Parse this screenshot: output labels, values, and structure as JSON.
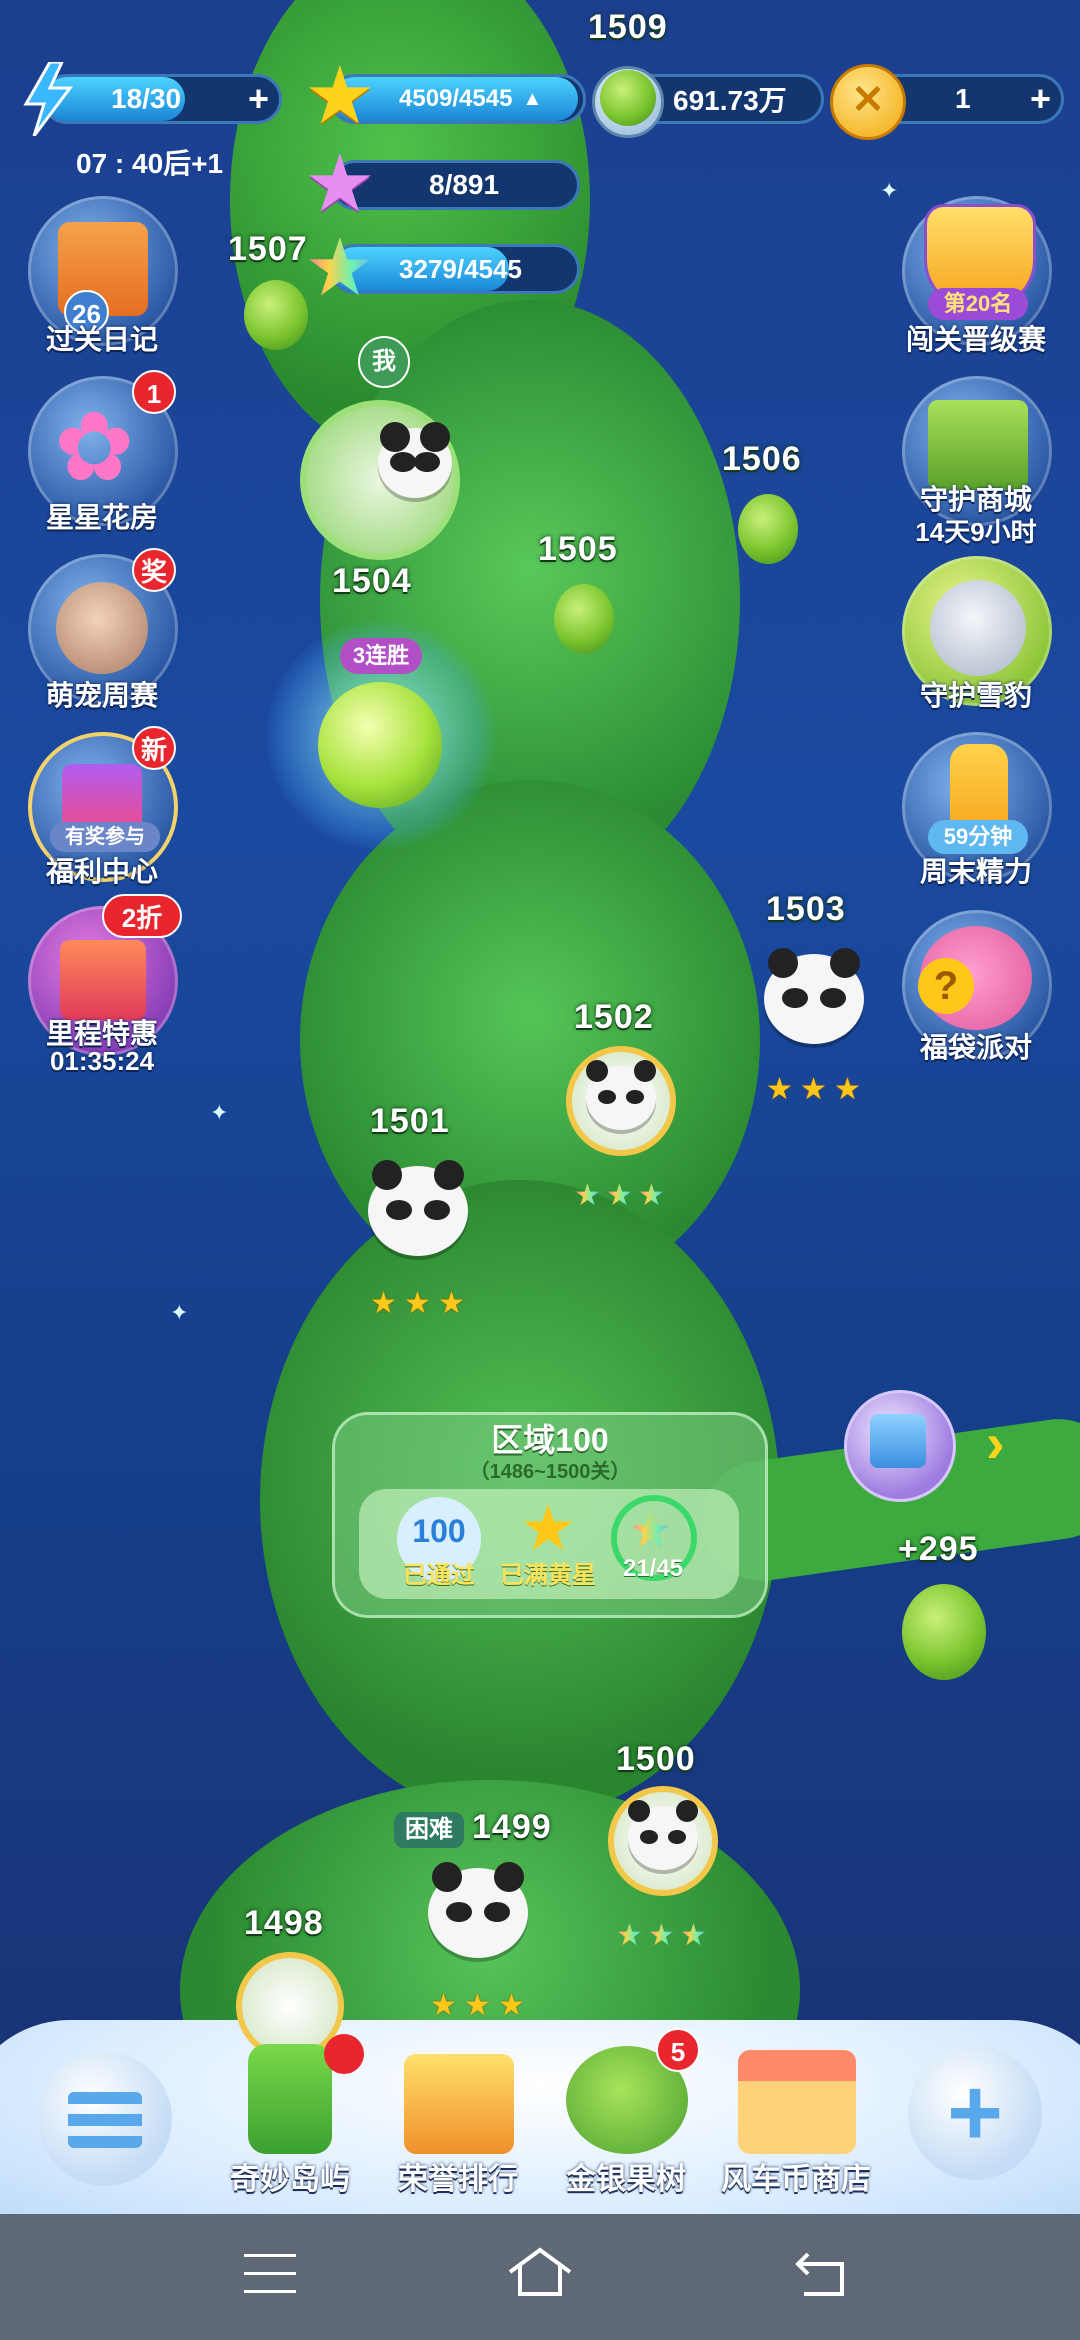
{
  "resources": {
    "energy": "18/30",
    "energy_timer": "07 : 40后+1",
    "gold_stars": "4509/4545",
    "pink_stars": "8/891",
    "rainbow_stars": "3279/4545",
    "windmill_coins": "691.73万",
    "gold_coins": "1",
    "plus": "+"
  },
  "left_menu": [
    {
      "label": "过关日记",
      "badge": "26"
    },
    {
      "label": "星星花房",
      "badge": "1"
    },
    {
      "label": "萌宠周赛",
      "badge": "奖"
    },
    {
      "label": "福利中心",
      "badge": "新",
      "sub": "有奖参与"
    },
    {
      "label": "里程特惠",
      "badge": "2折",
      "timer": "01:35:24"
    }
  ],
  "right_menu": [
    {
      "label": "闯关晋级赛",
      "sub": "第20名"
    },
    {
      "label": "守护商城",
      "timer": "14天9小时"
    },
    {
      "label": "守护雪豹"
    },
    {
      "label": "周末精力",
      "sub": "59分钟"
    },
    {
      "label": "福袋派对"
    }
  ],
  "levels": {
    "l1509": "1509",
    "l1507": "1507",
    "l1506": "1506",
    "l1505": "1505",
    "l1504": "1504",
    "l1504_streak": "3连胜",
    "me_marker": "我",
    "l1503": "1503",
    "l1502": "1502",
    "l1501": "1501",
    "l1500": "1500",
    "l1499": "1499",
    "l1499_tag": "困难",
    "l1498": "1498"
  },
  "region": {
    "title": "区域100",
    "range": "（1486~1500关）",
    "passed_num": "100",
    "passed_label": "已通过",
    "stars_label": "已满黄星",
    "rainbow_progress": "21/45"
  },
  "side_reward": {
    "bonus": "+295"
  },
  "bottom_menu": [
    {
      "label": "奇妙岛屿"
    },
    {
      "label": "荣誉排行"
    },
    {
      "label": "金银果树",
      "badge": "5"
    },
    {
      "label": "风车币商店"
    }
  ],
  "colors": {
    "accent_gold": "#ffc71a",
    "badge_red": "#e9262d",
    "stem_green": "#3fae3a"
  }
}
